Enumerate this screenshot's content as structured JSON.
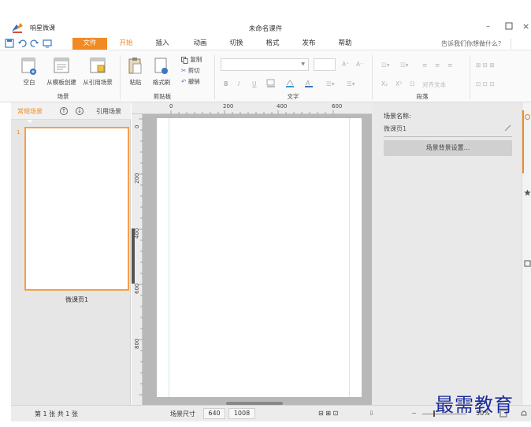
{
  "titlebar": {
    "app_name": "响星微课",
    "doc_title": "未命名课件",
    "min": "–",
    "close": "×"
  },
  "tabs": {
    "file": "文件",
    "home": "开始",
    "insert": "插入",
    "animation": "动画",
    "transition": "切换",
    "format": "格式",
    "publish": "发布",
    "help": "帮助"
  },
  "help_search": "告诉我们你想做什么？",
  "ribbon": {
    "scene_group": {
      "label": "场景",
      "blank": "空白",
      "from_template": "从模板创建",
      "from_ref": "从引用场景"
    },
    "clipboard_group": {
      "label": "剪贴板",
      "paste": "粘贴",
      "format_painter": "格式刷",
      "copy": "复制",
      "cut": "剪切",
      "undo": "撤销"
    },
    "text_group": {
      "label": "文字",
      "bold": "B",
      "italic": "I",
      "underline": "U",
      "grow": "A⁺",
      "shrink": "A⁻"
    },
    "paragraph_group": {
      "label": "段落",
      "align_text": "对齐文本"
    }
  },
  "left_panel": {
    "tab_normal": "常规场景",
    "up": "↑",
    "down": "↓",
    "tab_ref": "引用场景",
    "slides": [
      {
        "num": "1",
        "name": "微课页1"
      }
    ]
  },
  "ruler": {
    "top": [
      "0",
      "200",
      "400",
      "600"
    ],
    "left": [
      "0",
      "200",
      "400",
      "600",
      "800"
    ]
  },
  "right_panel": {
    "scene_name_label": "场景名称:",
    "scene_name_value": "微课页1",
    "bg_settings": "场景背景设置..."
  },
  "statusbar": {
    "page_info": "第 1 张 共 1 张",
    "size_label": "场景尺寸",
    "width": "640",
    "height": "1008",
    "zoom": "50%"
  },
  "watermark": "最需教育",
  "colors": {
    "accent": "#f08a24",
    "ribbon_bg": "#fafafa",
    "canvas_bg": "#b8b8b8",
    "panel_bg": "#e6e6e6"
  }
}
